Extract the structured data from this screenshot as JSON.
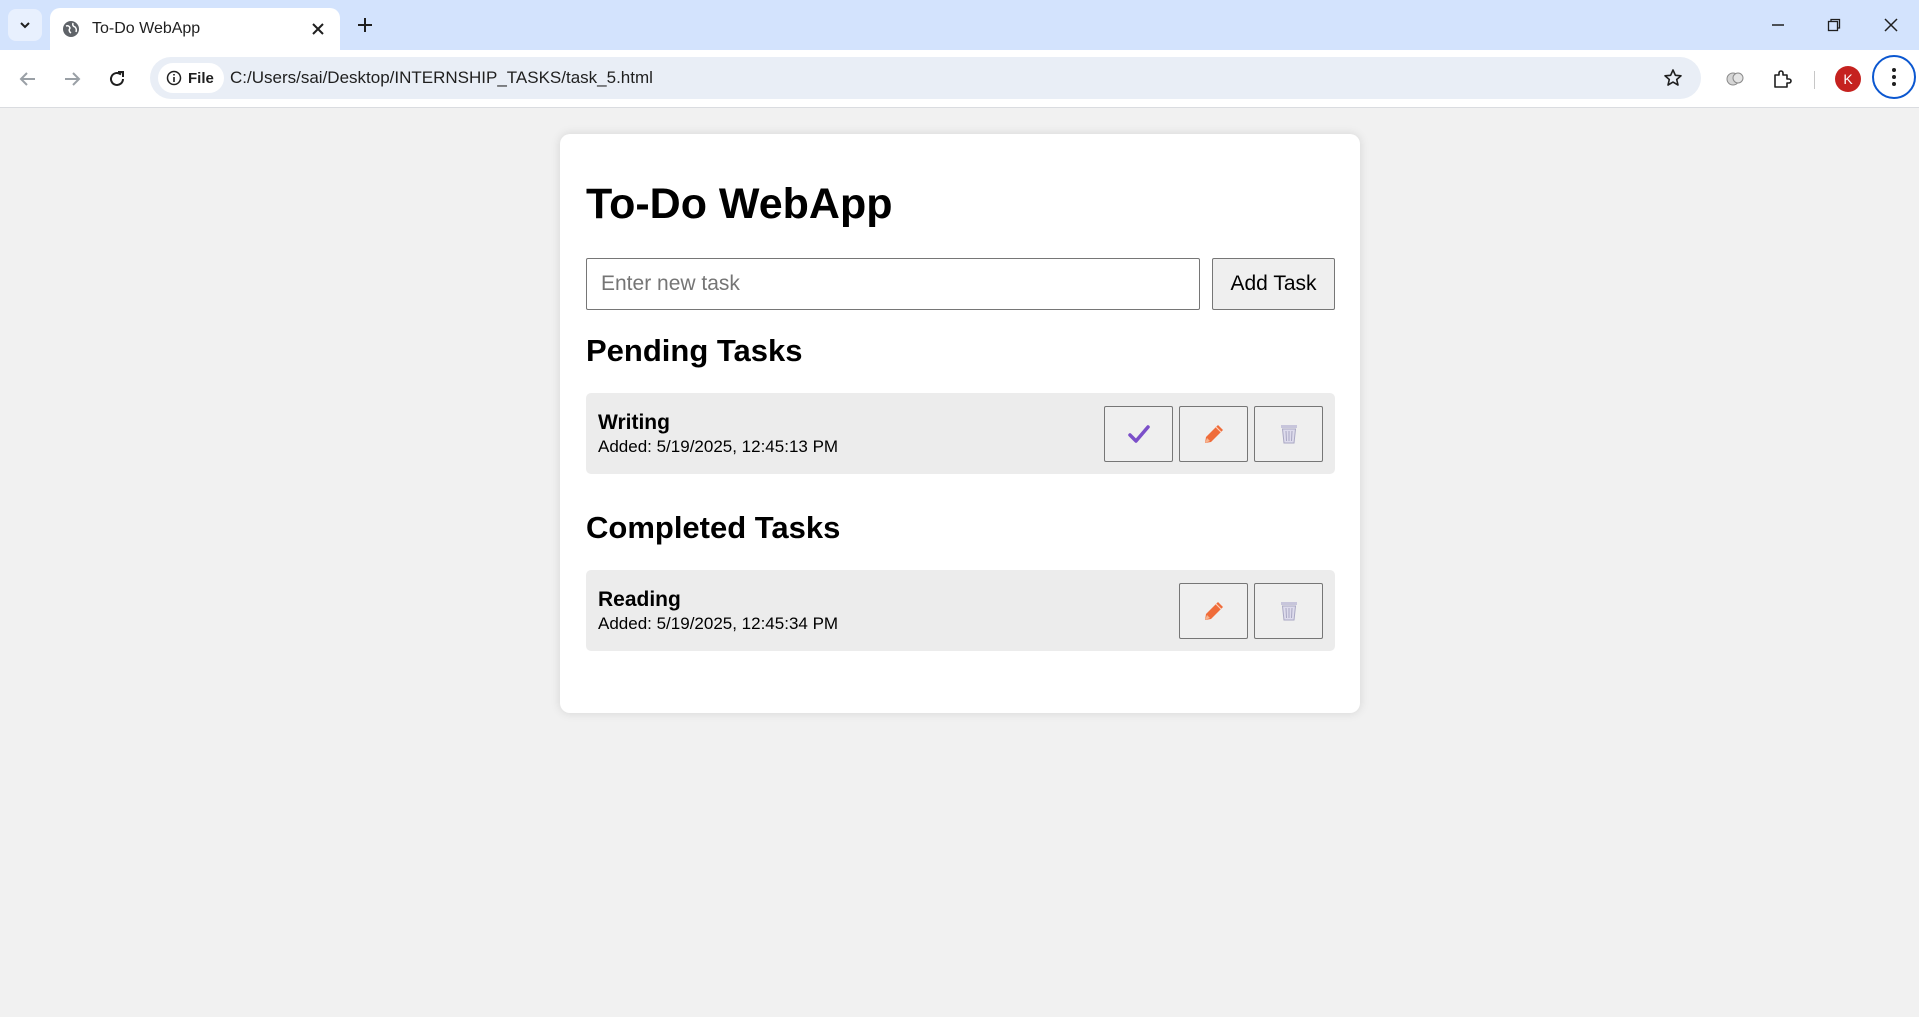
{
  "browser": {
    "tab_title": "To-Do WebApp",
    "chip_label": "File",
    "url": "C:/Users/sai/Desktop/INTERNSHIP_TASKS/task_5.html",
    "profile_initial": "K"
  },
  "app": {
    "title": "To-Do WebApp",
    "input_placeholder": "Enter new task",
    "input_value": "",
    "add_button_label": "Add Task"
  },
  "pending": {
    "heading": "Pending Tasks",
    "tasks": [
      {
        "name": "Writing",
        "date": "Added: 5/19/2025, 12:45:13 PM"
      }
    ]
  },
  "completed": {
    "heading": "Completed Tasks",
    "tasks": [
      {
        "name": "Reading",
        "date": "Added: 5/19/2025, 12:45:34 PM"
      }
    ]
  },
  "colors": {
    "check": "#7b4fc9",
    "pencil": "#ef6c3a",
    "trash": "#b9b7cf",
    "avatar": "#c5221f",
    "tabbar": "#d3e3fd"
  },
  "icons": [
    "chevron-down-icon",
    "globe-icon",
    "close-icon",
    "plus-icon",
    "back-arrow-icon",
    "forward-arrow-icon",
    "reload-icon",
    "info-icon",
    "star-icon",
    "lens-icon",
    "extensions-icon",
    "kebab-menu-icon",
    "check-icon",
    "pencil-icon",
    "trash-icon"
  ]
}
